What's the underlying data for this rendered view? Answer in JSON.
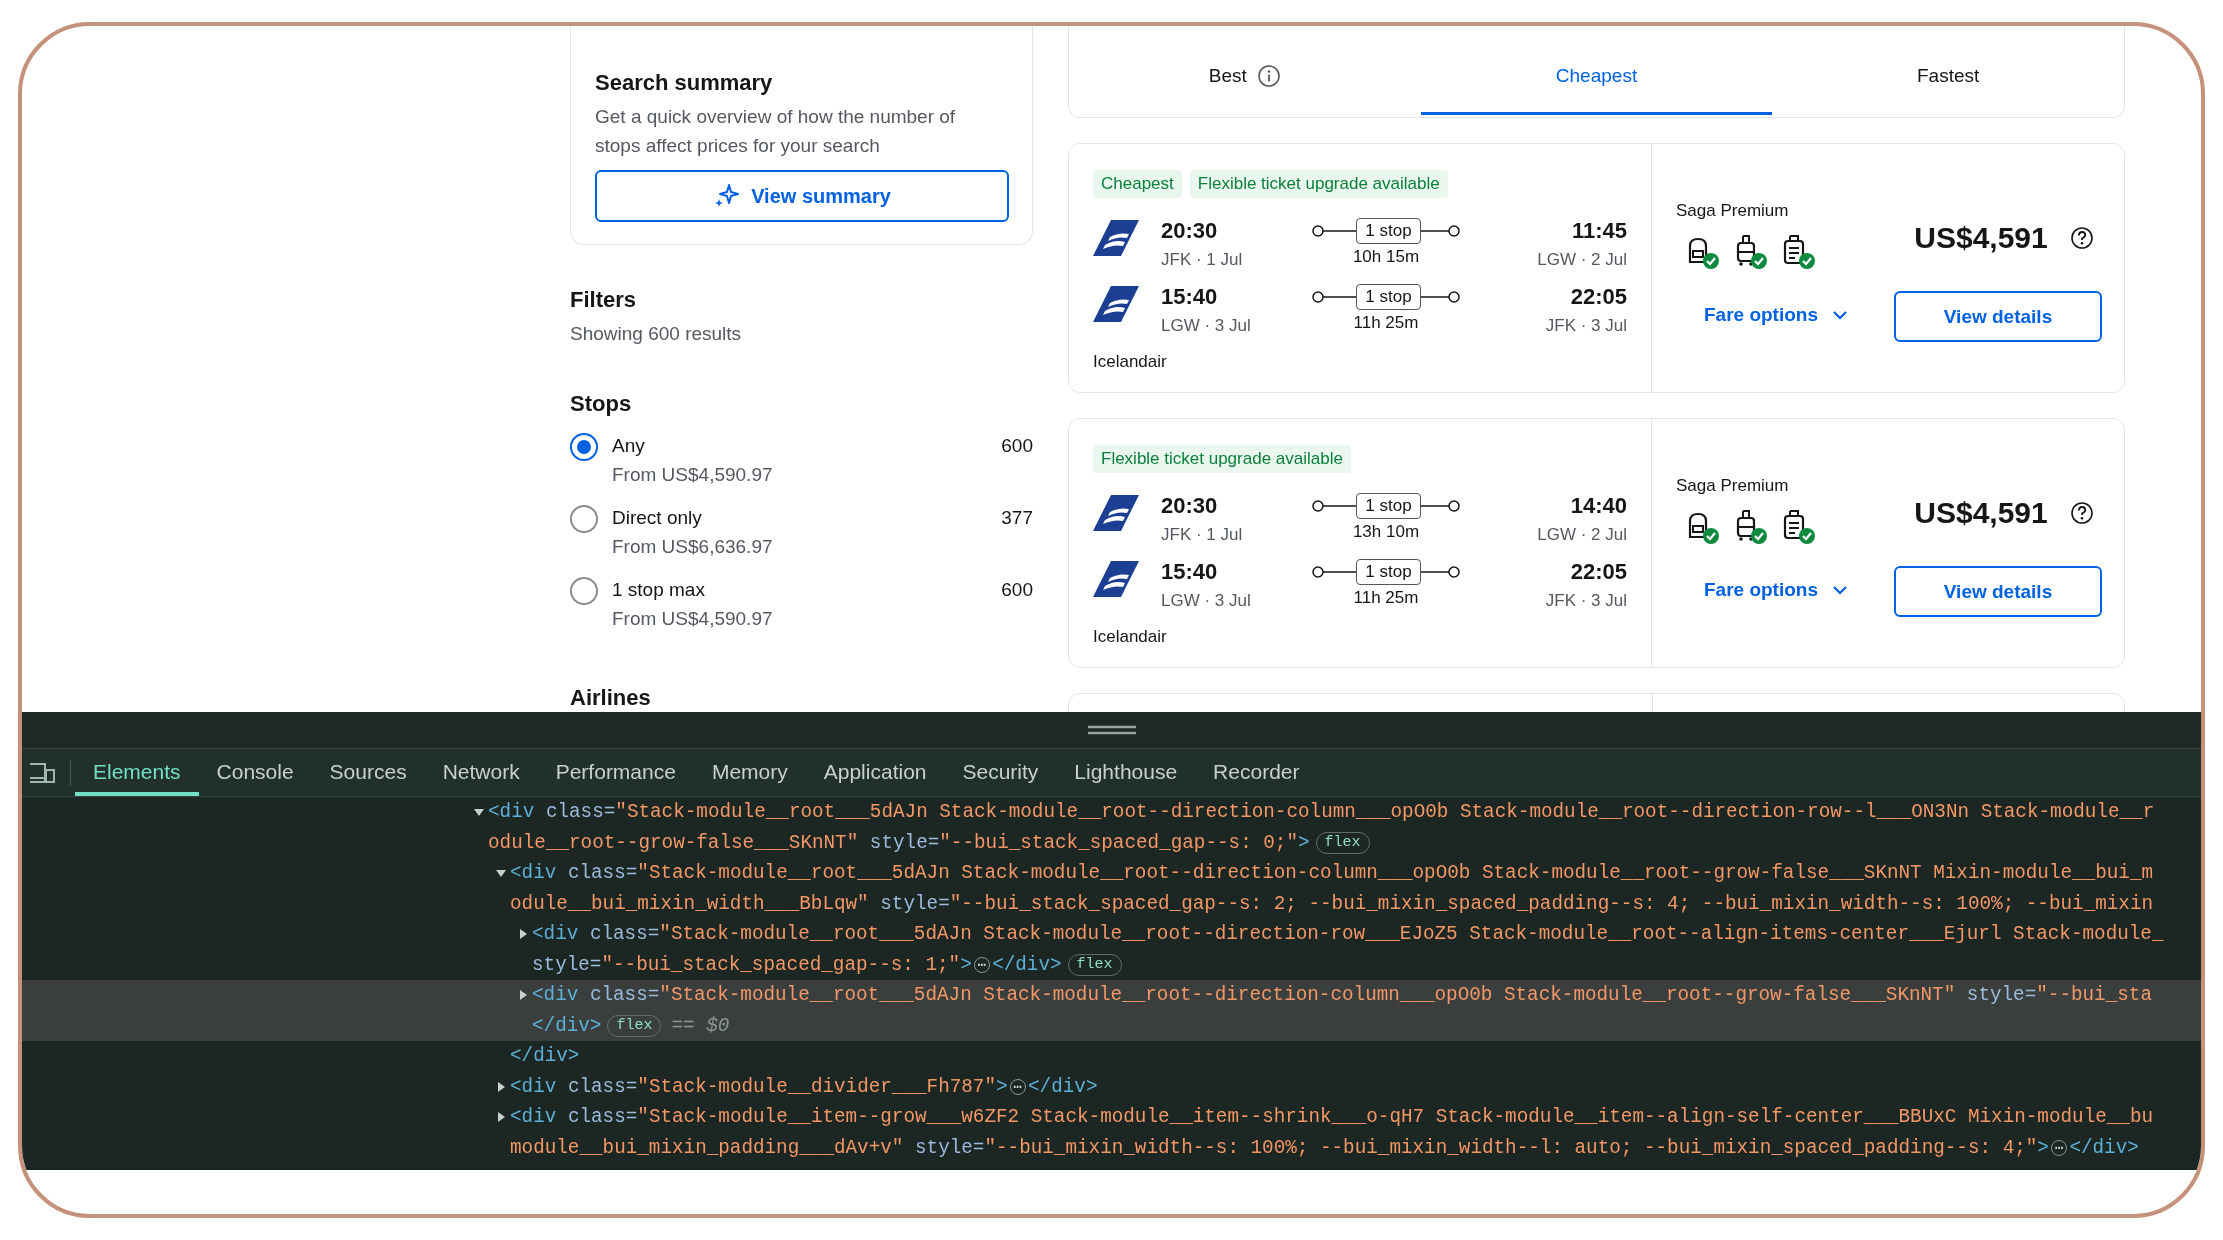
{
  "search_summary": {
    "title": "Search summary",
    "description": "Get a quick overview of how the number of stops affect prices for your search",
    "button": "View summary"
  },
  "filters": {
    "title": "Filters",
    "subtitle": "Showing 600 results",
    "stops": {
      "title": "Stops",
      "options": [
        {
          "label": "Any",
          "from": "From US$4,590.97",
          "count": "600",
          "selected": true
        },
        {
          "label": "Direct only",
          "from": "From US$6,636.97",
          "count": "377",
          "selected": false
        },
        {
          "label": "1 stop max",
          "from": "From US$4,590.97",
          "count": "600",
          "selected": false
        }
      ]
    },
    "airlines": {
      "title": "Airlines"
    }
  },
  "results": {
    "tabs": [
      {
        "label": "Best",
        "selected": false,
        "info_icon": true
      },
      {
        "label": "Cheapest",
        "selected": true,
        "info_icon": false
      },
      {
        "label": "Fastest",
        "selected": false,
        "info_icon": false
      }
    ],
    "flights": [
      {
        "tags": [
          "Cheapest",
          "Flexible ticket upgrade available"
        ],
        "legs": [
          {
            "depart_time": "20:30",
            "depart_place": "JFK · 1 Jul",
            "stops": "1 stop",
            "duration": "10h 15m",
            "arrive_time": "11:45",
            "arrive_place": "LGW · 2 Jul"
          },
          {
            "depart_time": "15:40",
            "depart_place": "LGW · 3 Jul",
            "stops": "1 stop",
            "duration": "11h 25m",
            "arrive_time": "22:05",
            "arrive_place": "JFK · 3 Jul"
          }
        ],
        "airline": "Icelandair",
        "fare_name": "Saga Premium",
        "price": "US$4,591",
        "fare_options": "Fare options",
        "details_button": "View details"
      },
      {
        "tags": [
          "Flexible ticket upgrade available"
        ],
        "legs": [
          {
            "depart_time": "20:30",
            "depart_place": "JFK · 1 Jul",
            "stops": "1 stop",
            "duration": "13h 10m",
            "arrive_time": "14:40",
            "arrive_place": "LGW · 2 Jul"
          },
          {
            "depart_time": "15:40",
            "depart_place": "LGW · 3 Jul",
            "stops": "1 stop",
            "duration": "11h 25m",
            "arrive_time": "22:05",
            "arrive_place": "JFK · 3 Jul"
          }
        ],
        "airline": "Icelandair",
        "fare_name": "Saga Premium",
        "price": "US$4,591",
        "fare_options": "Fare options",
        "details_button": "View details"
      }
    ]
  },
  "devtools": {
    "tabs": [
      {
        "label": "Elements",
        "selected": true
      },
      {
        "label": "Console",
        "selected": false
      },
      {
        "label": "Sources",
        "selected": false
      },
      {
        "label": "Network",
        "selected": false
      },
      {
        "label": "Performance",
        "selected": false
      },
      {
        "label": "Memory",
        "selected": false
      },
      {
        "label": "Application",
        "selected": false
      },
      {
        "label": "Security",
        "selected": false
      },
      {
        "label": "Lighthouse",
        "selected": false
      },
      {
        "label": "Recorder",
        "selected": false
      }
    ],
    "nodes": [
      {
        "expanded": true,
        "selected": false,
        "rows": [
          "<div class=\"Stack-module__root___5dAJn Stack-module__root--direction-column___opO0b Stack-module__root--direction-row--l___ON3Nn Stack-module__r",
          "odule__root--grow-false___SKnNT\" style=\"--bui_stack_spaced_gap--s: 0;\">"
        ],
        "badge": "flex",
        "children": [
          {
            "expanded": true,
            "selected": false,
            "rows": [
              "<div class=\"Stack-module__root___5dAJn Stack-module__root--direction-column___opO0b Stack-module__root--grow-false___SKnNT Mixin-module__bui_m",
              "odule__bui_mixin_width___BbLqw\" style=\"--bui_stack_spaced_gap--s: 2; --bui_mixin_spaced_padding--s: 4; --bui_mixin_width--s: 100%; --bui_mixin"
            ],
            "closing": "</div>",
            "children": [
              {
                "expanded": false,
                "selected": false,
                "rows": [
                  "<div class=\"Stack-module__root___5dAJn Stack-module__root--direction-row___EJoZ5 Stack-module__root--align-items-center___Ejurl Stack-module_",
                  "style=\"--bui_stack_spaced_gap--s: 1;\">"
                ],
                "ellipsis": "⋯",
                "end_tag": "</div>",
                "badge": "flex"
              },
              {
                "expanded": false,
                "selected": true,
                "rows": [
                  "<div class=\"Stack-module__root___5dAJn Stack-module__root--direction-column___opO0b Stack-module__root--grow-false___SKnNT\" style=\"--bui_sta",
                  "</div>"
                ],
                "badge": "flex",
                "suffix": "== $0"
              }
            ]
          },
          {
            "expanded": false,
            "selected": false,
            "rows": [
              "<div class=\"Stack-module__divider___Fh787\">"
            ],
            "ellipsis": "⋯",
            "end_tag": "</div>"
          },
          {
            "expanded": false,
            "selected": false,
            "rows": [
              "<div class=\"Stack-module__item--grow___w6ZF2 Stack-module__item--shrink___o-qH7 Stack-module__item--align-self-center___BBUxC Mixin-module__bu",
              "module__bui_mixin_padding___dAv+v\" style=\"--bui_mixin_width--s: 100%; --bui_mixin_width--l: auto; --bui_mixin_spaced_padding--s: 4;\">"
            ],
            "ellipsis": "⋯",
            "end_tag": "</div>"
          }
        ]
      }
    ]
  }
}
